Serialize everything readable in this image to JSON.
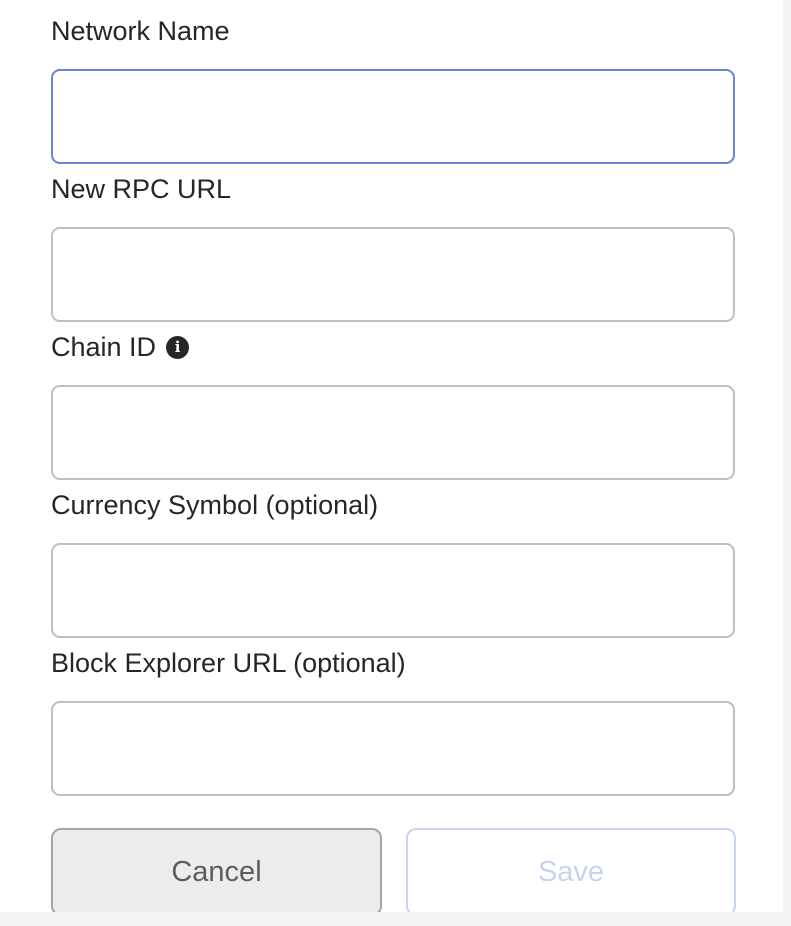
{
  "form": {
    "network_name": {
      "label": "Network Name",
      "value": "",
      "placeholder": ""
    },
    "rpc_url": {
      "label": "New RPC URL",
      "value": "",
      "placeholder": ""
    },
    "chain_id": {
      "label": "Chain ID",
      "info_icon": "info-icon",
      "value": "",
      "placeholder": ""
    },
    "currency_symbol": {
      "label": "Currency Symbol (optional)",
      "value": "",
      "placeholder": ""
    },
    "block_explorer_url": {
      "label": "Block Explorer URL (optional)",
      "value": "",
      "placeholder": ""
    }
  },
  "actions": {
    "cancel_label": "Cancel",
    "save_label": "Save"
  },
  "colors": {
    "focus_border": "#6a84d3",
    "input_border": "#bbc0c5",
    "text": "#24272a",
    "save_disabled": "#c7d3ef"
  }
}
